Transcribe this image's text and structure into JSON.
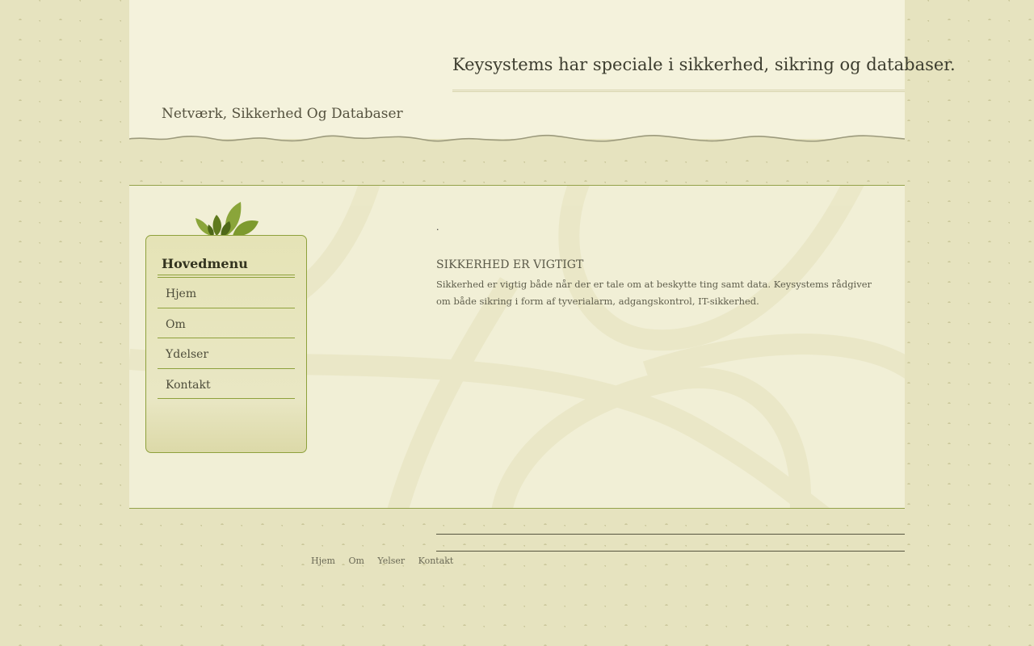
{
  "header": {
    "tagline": "Keysystems har speciale i sikkerhed, sikring og databaser.",
    "site_title": "Netværk, Sikkerhed Og Databaser"
  },
  "sidebar": {
    "heading": "Hovedmenu",
    "items": [
      {
        "label": "Hjem"
      },
      {
        "label": "Om"
      },
      {
        "label": "Ydelser"
      },
      {
        "label": "Kontakt"
      }
    ]
  },
  "main": {
    "marker": ".",
    "article": {
      "title": "SIKKERHED ER VIGTIGT",
      "body": "Sikkerhed er vigtig både når der er tale om at beskytte ting samt data. Keysystems rådgiver om både sikring i form af tyverialarm, adgangskontrol, IT-sikkerhed."
    }
  },
  "footer": {
    "links": [
      {
        "label": "Hjem"
      },
      {
        "label": "Om"
      },
      {
        "label": "Yelser"
      },
      {
        "label": "Kontakt"
      }
    ]
  },
  "colors": {
    "page_background": "#e6e3bf",
    "header_background": "#f4f2dc",
    "content_background": "#f1efd6",
    "accent_green": "#8ea13c",
    "leaf_dark": "#5f7a1e",
    "leaf_light": "#8aa53a"
  },
  "icons": {
    "menu_decoration": "leaves-icon",
    "background_pattern": "fleur-pattern"
  }
}
